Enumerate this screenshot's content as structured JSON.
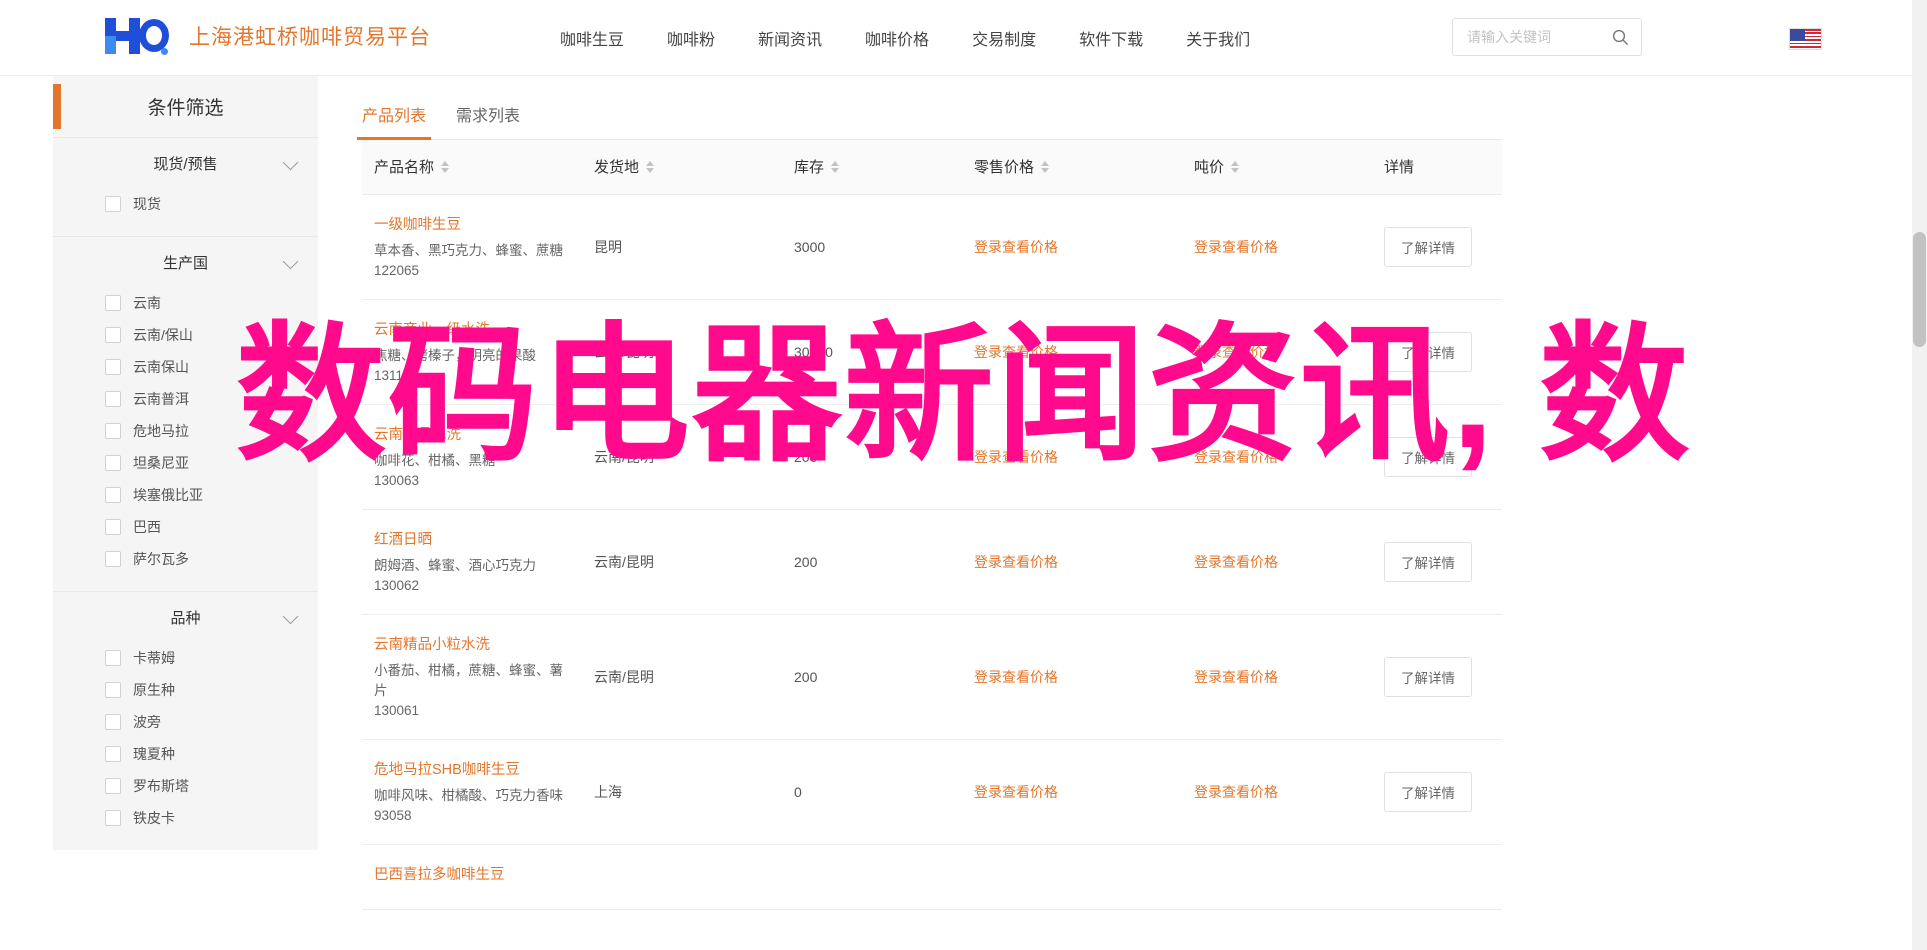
{
  "header": {
    "brand_name": "上海港虹桥咖啡贸易平台",
    "logo_alt": "HO",
    "nav_items": [
      {
        "label": "咖啡生豆"
      },
      {
        "label": "咖啡粉"
      },
      {
        "label": "新闻资讯"
      },
      {
        "label": "咖啡价格"
      },
      {
        "label": "交易制度"
      },
      {
        "label": "软件下载"
      },
      {
        "label": "关于我们"
      }
    ],
    "search": {
      "placeholder": "请输入关键词",
      "value": ""
    },
    "language_flag": "us-flag"
  },
  "sidebar": {
    "title": "条件筛选",
    "groups": [
      {
        "title": "现货/预售",
        "options": [
          {
            "label": "现货",
            "checked": false
          }
        ]
      },
      {
        "title": "生产国",
        "options": [
          {
            "label": "云南",
            "checked": false
          },
          {
            "label": "云南/保山",
            "checked": false
          },
          {
            "label": "云南保山",
            "checked": false
          },
          {
            "label": "云南普洱",
            "checked": false
          },
          {
            "label": "危地马拉",
            "checked": false
          },
          {
            "label": "坦桑尼亚",
            "checked": false
          },
          {
            "label": "埃塞俄比亚",
            "checked": false
          },
          {
            "label": "巴西",
            "checked": false
          },
          {
            "label": "萨尔瓦多",
            "checked": false
          }
        ]
      },
      {
        "title": "品种",
        "options": [
          {
            "label": "卡蒂姆",
            "checked": false
          },
          {
            "label": "原生种",
            "checked": false
          },
          {
            "label": "波旁",
            "checked": false
          },
          {
            "label": "瑰夏种",
            "checked": false
          },
          {
            "label": "罗布斯塔",
            "checked": false
          },
          {
            "label": "铁皮卡",
            "checked": false
          }
        ]
      }
    ]
  },
  "main": {
    "tabs": [
      {
        "label": "产品列表",
        "active": true
      },
      {
        "label": "需求列表",
        "active": false
      }
    ],
    "columns": [
      {
        "label": "产品名称",
        "sortable": true
      },
      {
        "label": "发货地",
        "sortable": true
      },
      {
        "label": "库存",
        "sortable": true
      },
      {
        "label": "零售价格",
        "sortable": true
      },
      {
        "label": "吨价",
        "sortable": true
      },
      {
        "label": "详情",
        "sortable": false
      }
    ],
    "rows": [
      {
        "name": "一级咖啡生豆",
        "desc": "草本香、黑巧克力、蜂蜜、蔗糖",
        "code": "122065",
        "ship": "昆明",
        "stock": "3000",
        "retail": "登录查看价格",
        "ton": "登录查看价格",
        "detail": "了解详情"
      },
      {
        "name": "云南商业一级水洗",
        "desc": "焦糖、烤榛子，明亮的果酸",
        "code": "131164",
        "ship": "云南/昆明",
        "stock": "30000",
        "retail": "登录查看价格",
        "ton": "登录查看价格",
        "detail": "了解详情"
      },
      {
        "name": "云南精品水洗",
        "desc": "咖啡花、柑橘、黑糖",
        "code": "130063",
        "ship": "云南/昆明",
        "stock": "200",
        "retail": "登录查看价格",
        "ton": "登录查看价格",
        "detail": "了解详情"
      },
      {
        "name": "红酒日晒",
        "desc": "朗姆酒、蜂蜜、酒心巧克力",
        "code": "130062",
        "ship": "云南/昆明",
        "stock": "200",
        "retail": "登录查看价格",
        "ton": "登录查看价格",
        "detail": "了解详情"
      },
      {
        "name": "云南精品小粒水洗",
        "desc": "小番茄、柑橘，蔗糖、蜂蜜、薯片",
        "code": "130061",
        "ship": "云南/昆明",
        "stock": "200",
        "retail": "登录查看价格",
        "ton": "登录查看价格",
        "detail": "了解详情"
      },
      {
        "name": "危地马拉SHB咖啡生豆",
        "desc": "咖啡风味、柑橘酸、巧克力香味",
        "code": "93058",
        "ship": "上海",
        "stock": "0",
        "retail": "登录查看价格",
        "ton": "登录查看价格",
        "detail": "了解详情"
      },
      {
        "name": "巴西喜拉多咖啡生豆",
        "desc": "",
        "code": "",
        "ship": "",
        "stock": "",
        "retail": "",
        "ton": "",
        "detail": ""
      }
    ]
  },
  "overlay": {
    "watermark_text": "数码电器新闻资讯, 数"
  },
  "colors": {
    "accent": "#e3762a",
    "watermark": "#ff0a8c",
    "sidebar_bg": "#f5f5f5",
    "logo_blue": "#1f4fd8"
  }
}
